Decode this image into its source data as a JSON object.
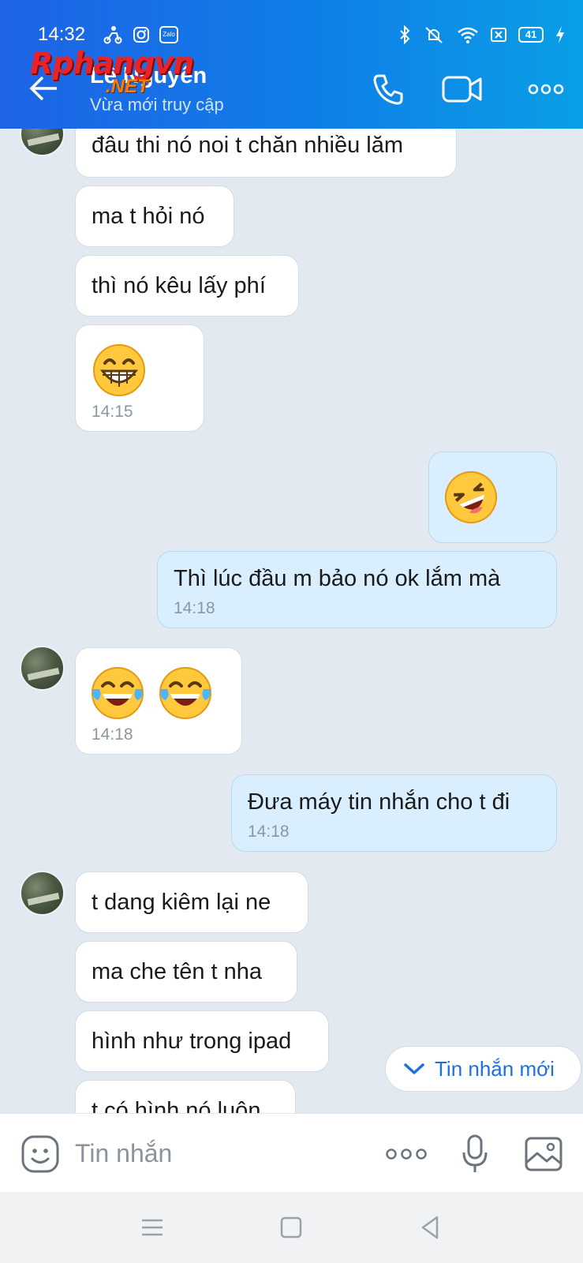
{
  "status_bar": {
    "time": "14:32",
    "zalo_label": "Zalo",
    "battery": "41"
  },
  "watermark": {
    "main": "Rphangvn",
    "sub": ".NET"
  },
  "header": {
    "contact_name": "Lê Nguyên",
    "contact_status": "Vừa mới truy cập",
    "icons": [
      "back-arrow-icon",
      "phone-call-icon",
      "video-call-icon",
      "more-options-icon"
    ],
    "gradient": [
      "#1e63e6",
      "#0a9fe6"
    ]
  },
  "messages": [
    {
      "side": "left",
      "text": "đâu thi nó noi t chăn nhiều lăm"
    },
    {
      "side": "left",
      "text": "ma t hỏi nó"
    },
    {
      "side": "left",
      "text": "thì nó kêu lấy phí"
    },
    {
      "side": "left",
      "emoji": [
        "grinning-face"
      ],
      "time": "14:15"
    },
    {
      "side": "right",
      "emoji": [
        "laughing-face"
      ]
    },
    {
      "side": "right",
      "text": "Thì lúc đầu m bảo nó ok lắm mà",
      "time": "14:18"
    },
    {
      "side": "left",
      "emoji": [
        "tears-of-joy-face",
        "tears-of-joy-face"
      ],
      "time": "14:18"
    },
    {
      "side": "right",
      "text": "Đưa máy tin nhắn cho t đi",
      "time": "14:18"
    },
    {
      "side": "left",
      "text": "t dang kiêm lại ne"
    },
    {
      "side": "left",
      "text": "ma che tên t nha"
    },
    {
      "side": "left",
      "text": "hình như trong ipad"
    },
    {
      "side": "left",
      "text": "t có hình nó luôn"
    }
  ],
  "new_messages_button": "Tin nhắn mới",
  "composer": {
    "placeholder": "Tin nhắn",
    "icons": [
      "sticker-icon",
      "more-icon",
      "microphone-icon",
      "image-icon"
    ]
  },
  "nav": {
    "icons": [
      "menu-icon",
      "home-icon",
      "back-icon"
    ]
  },
  "colors": {
    "mine_bubble": "#d9efff",
    "theirs_bubble": "#ffffff",
    "chat_bg": "#e2e9f1",
    "accent": "#1e6fe0"
  }
}
